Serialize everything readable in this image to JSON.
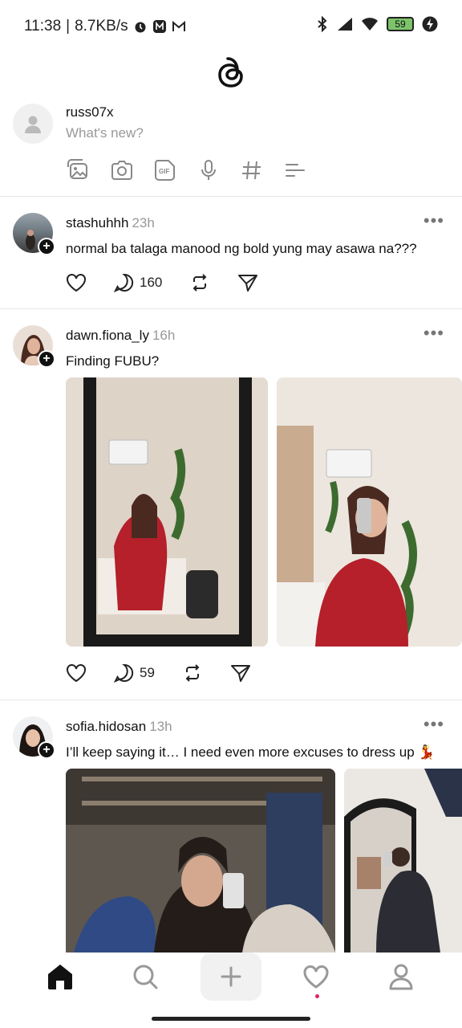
{
  "status_bar": {
    "time": "11:38",
    "speed": "8.7KB/s",
    "battery": "59"
  },
  "app": {
    "logo_icon": "threads-logo-icon"
  },
  "composer": {
    "username": "russ07x",
    "placeholder": "What's new?",
    "tools": [
      "gallery-icon",
      "camera-icon",
      "gif-icon",
      "microphone-icon",
      "hashtag-icon",
      "poll-icon"
    ]
  },
  "posts": [
    {
      "username": "stashuhhh",
      "time": "23h",
      "text": "normal ba talaga manood ng bold yung may asawa na???",
      "replies": "160"
    },
    {
      "username": "dawn.fiona_ly",
      "time": "16h",
      "text": "Finding FUBU?",
      "replies": "59"
    },
    {
      "username": "sofia.hidosan",
      "time": "13h",
      "text": "I’ll keep saying it… I need even more excuses to dress up 💃"
    }
  ],
  "colors": {
    "accent_dot": "#e0245e",
    "text_primary": "#111111",
    "text_secondary": "#999999"
  },
  "nav": [
    "home-icon",
    "search-icon",
    "create-icon",
    "activity-icon",
    "profile-icon"
  ]
}
